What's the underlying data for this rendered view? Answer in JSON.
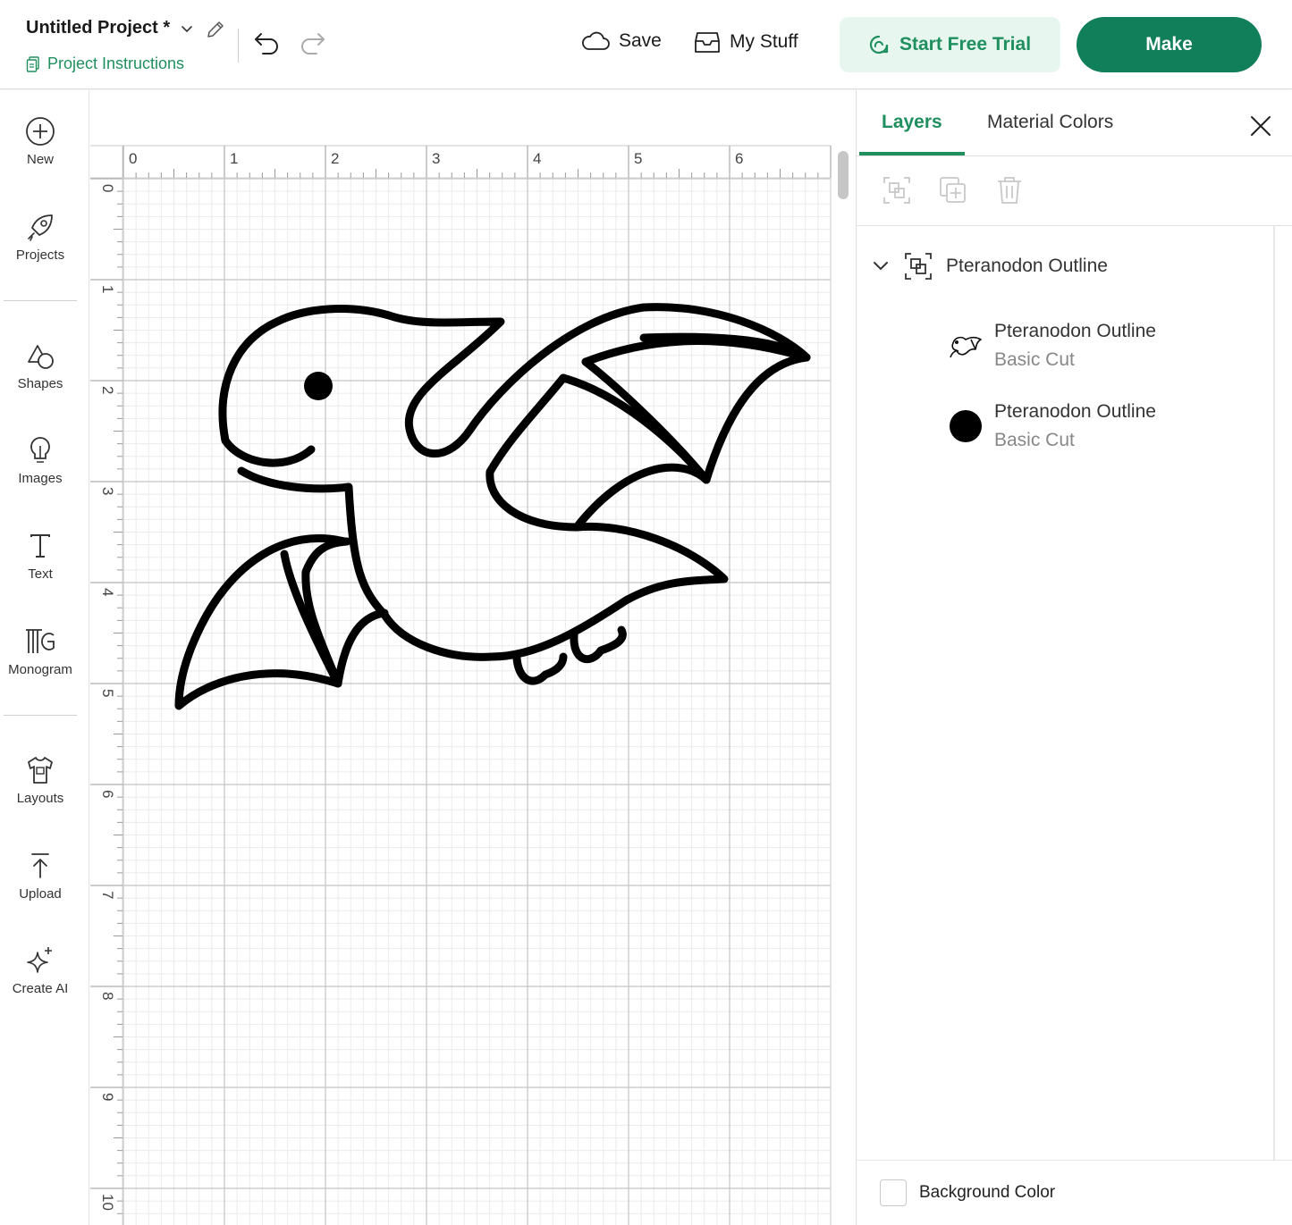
{
  "header": {
    "project_title": "Untitled Project *",
    "project_instructions": "Project Instructions",
    "save_label": "Save",
    "mystuff_label": "My Stuff",
    "trial_label": "Start Free Trial",
    "make_label": "Make"
  },
  "leftbar": {
    "tools": [
      {
        "label": "New",
        "icon": "plus-circle-icon"
      },
      {
        "label": "Projects",
        "icon": "rocket-icon"
      },
      {
        "label": "Shapes",
        "icon": "shapes-icon"
      },
      {
        "label": "Images",
        "icon": "lightbulb-icon"
      },
      {
        "label": "Text",
        "icon": "text-icon"
      },
      {
        "label": "Monogram",
        "icon": "monogram-icon"
      },
      {
        "label": "Layouts",
        "icon": "shirt-icon"
      },
      {
        "label": "Upload",
        "icon": "upload-icon"
      },
      {
        "label": "Create AI",
        "icon": "sparkle-icon"
      }
    ]
  },
  "canvas": {
    "ruler_x": [
      "0",
      "1",
      "2",
      "3",
      "4",
      "5",
      "6"
    ],
    "ruler_y": [
      "0",
      "1",
      "2",
      "3",
      "4",
      "5",
      "6",
      "7",
      "8",
      "9",
      "10"
    ],
    "image_name": "Pteranodon Outline"
  },
  "panel": {
    "tabs": [
      "Layers",
      "Material Colors"
    ],
    "group_label": "Pteranodon Outline",
    "layers": [
      {
        "name": "Pteranodon Outline",
        "operation": "Basic Cut",
        "thumb": "pteranodon-thumb"
      },
      {
        "name": "Pteranodon Outline",
        "operation": "Basic Cut",
        "thumb": "black-dot-thumb"
      }
    ],
    "background_color_label": "Background Color"
  },
  "colors": {
    "accent_green": "#1f8f5e",
    "make_button": "#107f5a",
    "trial_bg": "#e7f6ef"
  }
}
